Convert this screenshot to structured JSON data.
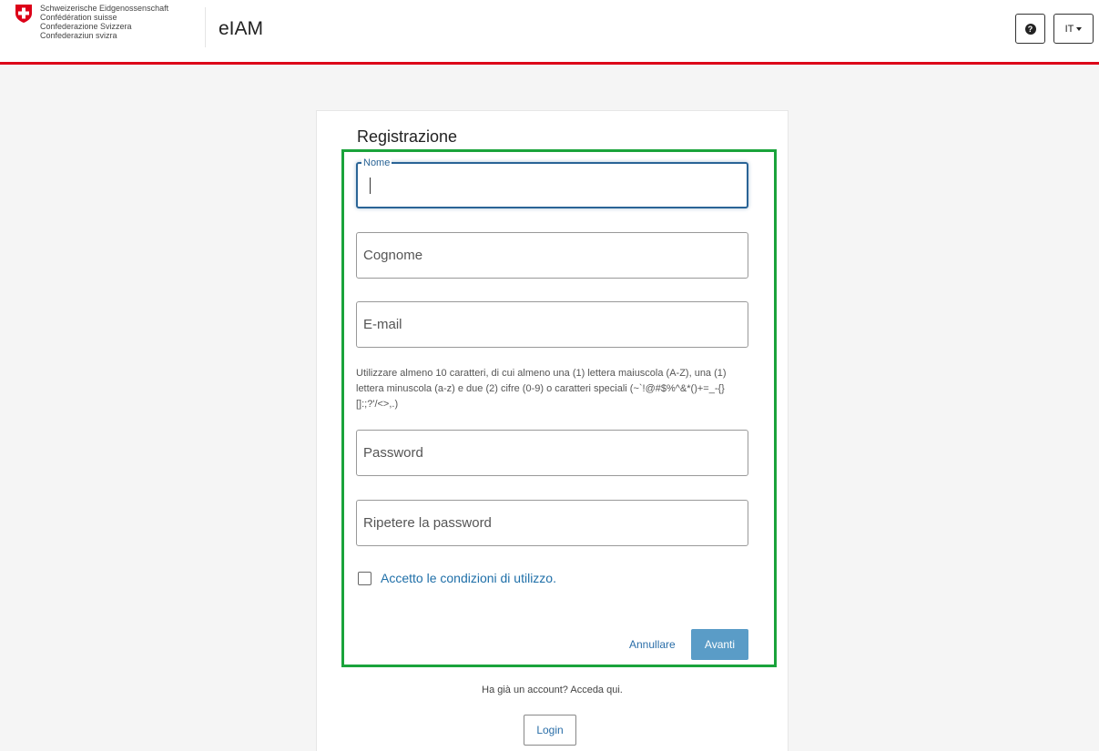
{
  "header": {
    "federation_names": [
      "Schweizerische Eidgenossenschaft",
      "Confédération suisse",
      "Confederazione Svizzera",
      "Confederaziun svizra"
    ],
    "app_title": "eIAM",
    "help_icon": "question-circle-icon",
    "help_glyph": "?",
    "language": "IT",
    "brand_color": "#dc0018"
  },
  "form": {
    "title": "Registrazione",
    "first_name_label": "Nome",
    "first_name_value": "",
    "last_name_placeholder": "Cognome",
    "email_placeholder": "E-mail",
    "password_hint": "Utilizzare almeno 10 caratteri, di cui almeno una (1) lettera maiuscola (A-Z), una (1) lettera minuscola (a-z) e due (2) cifre (0-9) o caratteri speciali (~`!@#$%^&*()+=_-{}[]:;?'/<>,.)",
    "password_placeholder": "Password",
    "repeat_password_placeholder": "Ripetere la password",
    "terms_checked": false,
    "terms_label": "Accetto le condizioni di utilizzo.",
    "cancel_label": "Annullare",
    "next_label": "Avanti",
    "highlight_color": "#1aa33b"
  },
  "footer": {
    "have_account_text": "Ha già un account? Acceda qui.",
    "login_label": "Login"
  }
}
